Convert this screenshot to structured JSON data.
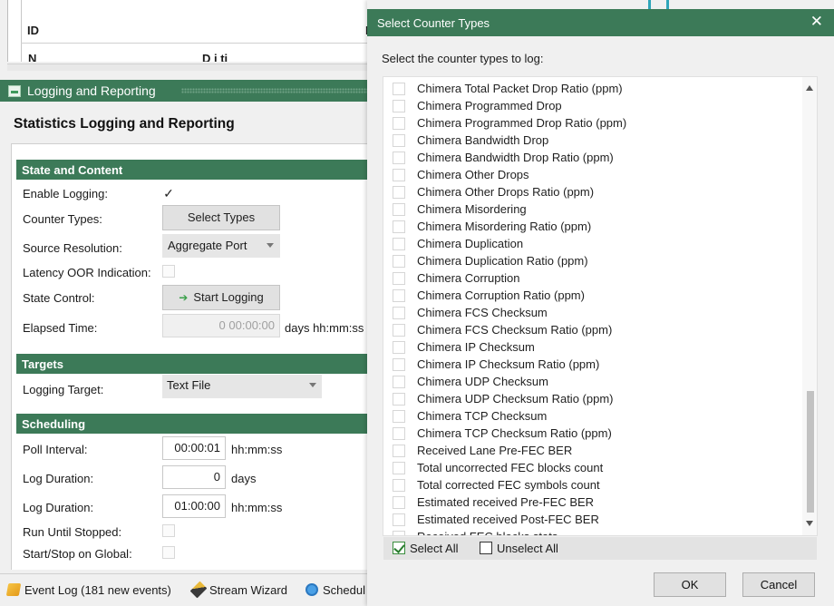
{
  "background": {
    "id_table": {
      "col_id": "ID",
      "col_mi": "MI",
      "row2_col1": "N",
      "row2_col2": "D  i  ti"
    },
    "section_bar": {
      "title": "Logging and Reporting"
    },
    "page_title": "Statistics Logging and Reporting",
    "state_and_content": {
      "header": "State and Content",
      "enable_logging_label": "Enable Logging:",
      "enable_logging_checked": true,
      "counter_types_label": "Counter Types:",
      "select_types_button": "Select Types",
      "source_resolution_label": "Source Resolution:",
      "source_resolution_value": "Aggregate Port",
      "latency_oor_label": "Latency OOR Indication:",
      "state_control_label": "State Control:",
      "start_logging_button": "Start Logging",
      "elapsed_time_label": "Elapsed Time:",
      "elapsed_time_value": "0 00:00:00",
      "elapsed_time_unit": "days hh:mm:ss"
    },
    "targets": {
      "header": "Targets",
      "logging_target_label": "Logging Target:",
      "logging_target_value": "Text File"
    },
    "scheduling": {
      "header": "Scheduling",
      "poll_interval_label": "Poll Interval:",
      "poll_interval_value": "00:00:01",
      "poll_interval_unit": "hh:mm:ss",
      "log_duration_days_label": "Log Duration:",
      "log_duration_days_value": "0",
      "log_duration_days_unit": "days",
      "log_duration_time_label": "Log Duration:",
      "log_duration_time_value": "01:00:00",
      "log_duration_time_unit": "hh:mm:ss",
      "run_until_stopped_label": "Run Until Stopped:",
      "start_stop_global_label": "Start/Stop on Global:"
    },
    "tabs": {
      "event_log": "Event Log (181 new events)",
      "stream_wizard": "Stream Wizard",
      "schedule": "Schedul"
    }
  },
  "dialog": {
    "title": "Select Counter Types",
    "close_glyph": "✕",
    "prompt": "Select the counter types to log:",
    "items": [
      "Chimera Total Packet Drop Ratio (ppm)",
      "Chimera Programmed Drop",
      "Chimera Programmed Drop Ratio (ppm)",
      "Chimera Bandwidth Drop",
      "Chimera Bandwidth Drop Ratio (ppm)",
      "Chimera Other Drops",
      "Chimera Other Drops Ratio (ppm)",
      "Chimera Misordering",
      "Chimera Misordering Ratio (ppm)",
      "Chimera Duplication",
      "Chimera Duplication Ratio (ppm)",
      "Chimera Corruption",
      "Chimera Corruption Ratio (ppm)",
      "Chimera FCS Checksum",
      "Chimera FCS Checksum Ratio (ppm)",
      "Chimera IP Checksum",
      "Chimera IP Checksum Ratio (ppm)",
      "Chimera UDP Checksum",
      "Chimera UDP Checksum Ratio (ppm)",
      "Chimera TCP Checksum",
      "Chimera TCP Checksum Ratio (ppm)",
      "Received Lane Pre-FEC BER",
      "Total uncorrected FEC blocks count",
      "Total corrected FEC symbols count",
      "Estimated received Pre-FEC BER",
      "Estimated received Post-FEC BER",
      "Received FEC blocks stats"
    ],
    "select_all_label": "Select All",
    "select_all_checked": true,
    "unselect_all_label": "Unselect All",
    "ok_button": "OK",
    "cancel_button": "Cancel"
  }
}
